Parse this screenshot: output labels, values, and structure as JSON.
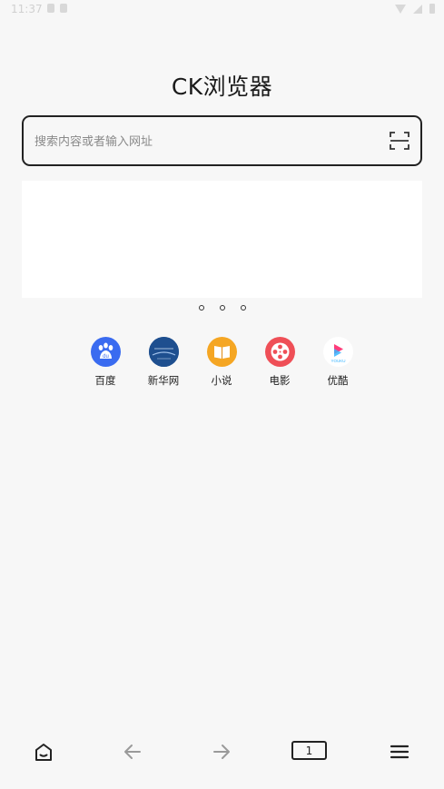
{
  "status_bar": {
    "time": "11:37"
  },
  "app": {
    "title": "CK浏览器"
  },
  "search": {
    "placeholder": "搜索内容或者输入网址",
    "value": ""
  },
  "banner": {
    "page_count": 3
  },
  "shortcuts": [
    {
      "label": "百度",
      "icon": "baidu-paw-icon",
      "color": "#3a6bf0"
    },
    {
      "label": "新华网",
      "icon": "xinhua-logo-icon",
      "color": "#1e4f8f"
    },
    {
      "label": "小说",
      "icon": "book-icon",
      "color": "#f5a623"
    },
    {
      "label": "电影",
      "icon": "film-reel-icon",
      "color": "#ef4f57"
    },
    {
      "label": "优酷",
      "icon": "youku-logo-icon",
      "color": "#ffffff"
    }
  ],
  "bottom_nav": {
    "tab_count": "1",
    "items": [
      "home-icon",
      "back-arrow-icon",
      "forward-arrow-icon",
      "tabs-counter",
      "menu-icon"
    ]
  }
}
